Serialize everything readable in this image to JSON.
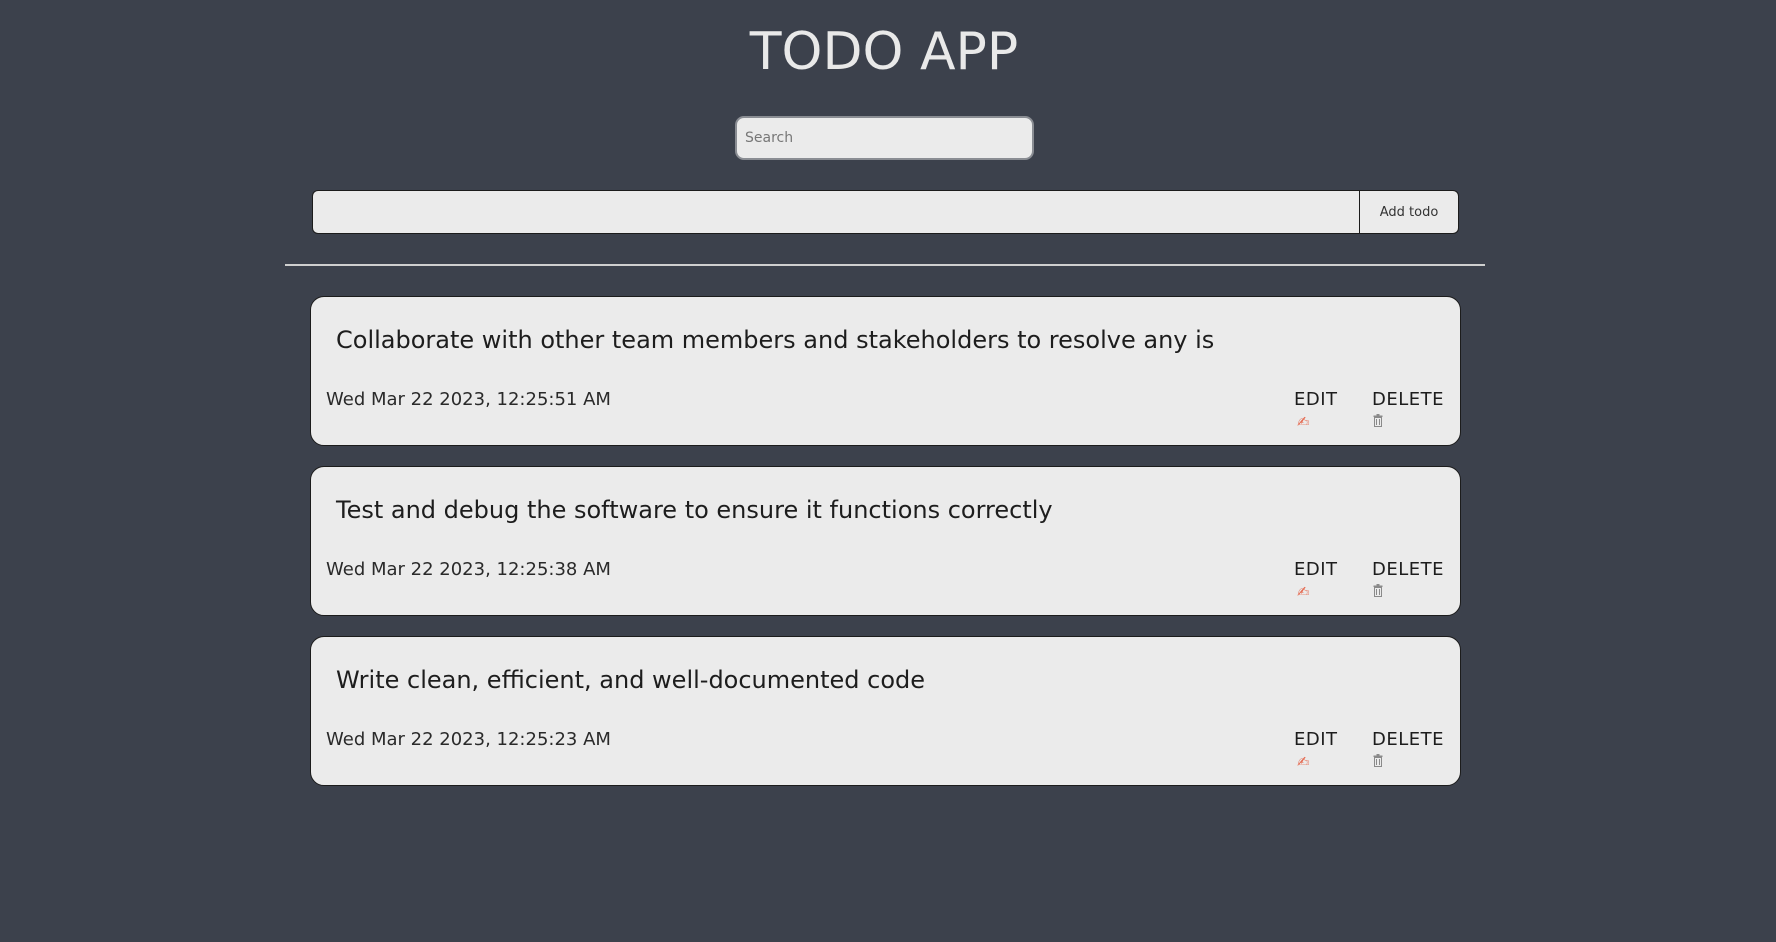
{
  "header": {
    "title": "TODO APP"
  },
  "search": {
    "placeholder": "Search",
    "value": ""
  },
  "add_form": {
    "input_value": "",
    "button_label": "Add todo"
  },
  "todos": [
    {
      "text": "Collaborate with other team members and stakeholders to resolve any is",
      "date": "Wed Mar 22 2023, 12:25:51 AM",
      "edit_label": "EDIT",
      "delete_label": "DELETE",
      "edit_icon": "writing-hand-icon",
      "delete_icon": "trash-can-icon"
    },
    {
      "text": "Test and debug the software to ensure it functions correctly",
      "date": "Wed Mar 22 2023, 12:25:38 AM",
      "edit_label": "EDIT",
      "delete_label": "DELETE",
      "edit_icon": "writing-hand-icon",
      "delete_icon": "trash-can-icon"
    },
    {
      "text": "Write clean, efficient, and well-documented code",
      "date": "Wed Mar 22 2023, 12:25:23 AM",
      "edit_label": "EDIT",
      "delete_label": "DELETE",
      "edit_icon": "writing-hand-icon",
      "delete_icon": "trash-can-icon"
    }
  ],
  "colors": {
    "background": "#3c414c",
    "card": "#ebebeb",
    "title": "#e9e9e9",
    "divider": "#cfcfcf",
    "edit_icon": "#e56b52"
  }
}
